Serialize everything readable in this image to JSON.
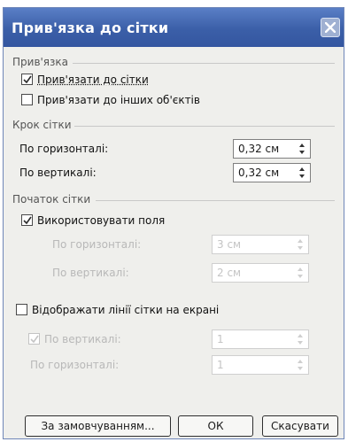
{
  "dialog": {
    "title": "Прив'язка до сітки",
    "close_icon": "close-icon"
  },
  "snap": {
    "section": "Прив'язка",
    "to_grid_label": "Прив'язати до сітки",
    "to_grid_checked": true,
    "to_objects_label": "Прив'язати до інших об'єктів",
    "to_objects_checked": false
  },
  "spacing": {
    "section": "Крок сітки",
    "horizontal_label": "По горизонталі:",
    "horizontal_value": "0,32 см",
    "vertical_label": "По вертикалі:",
    "vertical_value": "0,32 см"
  },
  "origin": {
    "section": "Початок сітки",
    "use_margins_label": "Використовувати поля",
    "use_margins_checked": true,
    "horizontal_label": "По горизонталі:",
    "horizontal_value": "3 см",
    "vertical_label": "По вертикалі:",
    "vertical_value": "2 см"
  },
  "display": {
    "show_lines_label": "Відображати лінії сітки на екрані",
    "show_lines_checked": false,
    "vertical_label": "По вертикалі:",
    "vertical_checked": true,
    "vertical_value": "1",
    "horizontal_label": "По горизонталі:",
    "horizontal_value": "1"
  },
  "buttons": {
    "default_label": "За замовчуванням...",
    "ok_label": "ОК",
    "cancel_label": "Скасувати"
  }
}
